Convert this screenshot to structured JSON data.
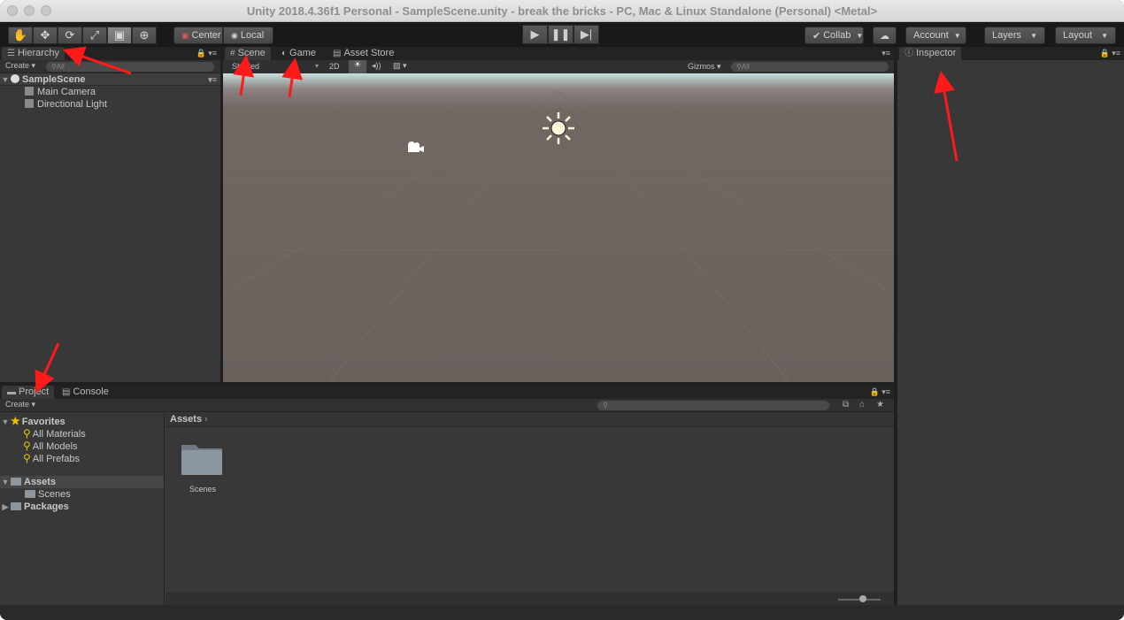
{
  "window": {
    "title": "Unity 2018.4.36f1 Personal - SampleScene.unity - break the bricks - PC, Mac & Linux Standalone (Personal) <Metal>"
  },
  "toolbar": {
    "tools": [
      "hand-icon",
      "move-icon",
      "rotate-icon",
      "scale-icon",
      "rect-icon",
      "transform-icon"
    ],
    "center_label": "Center",
    "local_label": "Local",
    "collab_label": "Collab",
    "account_label": "Account",
    "layers_label": "Layers",
    "layout_label": "Layout"
  },
  "hierarchy": {
    "tab_label": "Hierarchy",
    "create_label": "Create",
    "search_placeholder": "All",
    "scene_name": "SampleScene",
    "items": [
      "Main Camera",
      "Directional Light"
    ]
  },
  "scene": {
    "tabs": [
      "Scene",
      "Game",
      "Asset Store"
    ],
    "shading_mode": "Shaded",
    "two_d_label": "2D",
    "gizmos_label": "Gizmos",
    "search_placeholder": "All"
  },
  "inspector": {
    "tab_label": "Inspector"
  },
  "project": {
    "tabs": [
      "Project",
      "Console"
    ],
    "create_label": "Create",
    "favorites_label": "Favorites",
    "favorites": [
      "All Materials",
      "All Models",
      "All Prefabs"
    ],
    "assets_label": "Assets",
    "asset_children": [
      "Scenes"
    ],
    "packages_label": "Packages",
    "breadcrumb": "Assets",
    "folder_items": [
      "Scenes"
    ]
  },
  "colors": {
    "annotation_arrow": "#ff1a1a",
    "panel_bg": "#383838",
    "accent_favorite": "#f0c400"
  }
}
